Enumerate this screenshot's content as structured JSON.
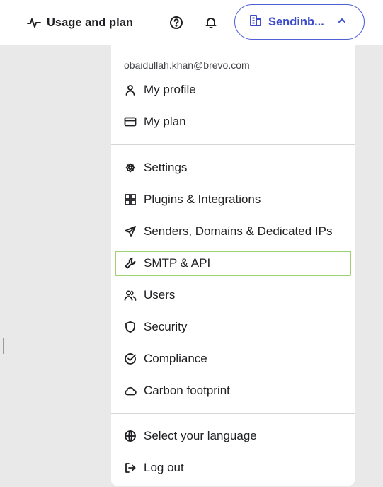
{
  "header": {
    "usage_label": "Usage and plan",
    "account_label": "Sendinb...",
    "accent_color": "#3c4bc9"
  },
  "menu": {
    "email": "obaidullah.khan@brevo.com",
    "profile_items": [
      {
        "label": "My profile",
        "icon": "user-icon"
      },
      {
        "label": "My plan",
        "icon": "credit-card-icon"
      }
    ],
    "settings_items": [
      {
        "label": "Settings",
        "icon": "gear-icon"
      },
      {
        "label": "Plugins & Integrations",
        "icon": "grid-icon"
      },
      {
        "label": "Senders, Domains & Dedicated IPs",
        "icon": "paper-plane-icon"
      },
      {
        "label": "SMTP & API",
        "icon": "wrench-icon",
        "selected": true
      },
      {
        "label": "Users",
        "icon": "users-icon"
      },
      {
        "label": "Security",
        "icon": "shield-icon"
      },
      {
        "label": "Compliance",
        "icon": "check-circle-icon"
      },
      {
        "label": "Carbon footprint",
        "icon": "cloud-icon"
      }
    ],
    "footer_items": [
      {
        "label": "Select your language",
        "icon": "globe-icon"
      },
      {
        "label": "Log out",
        "icon": "log-out-icon"
      }
    ],
    "selected_outline_color": "#9ed06f"
  }
}
